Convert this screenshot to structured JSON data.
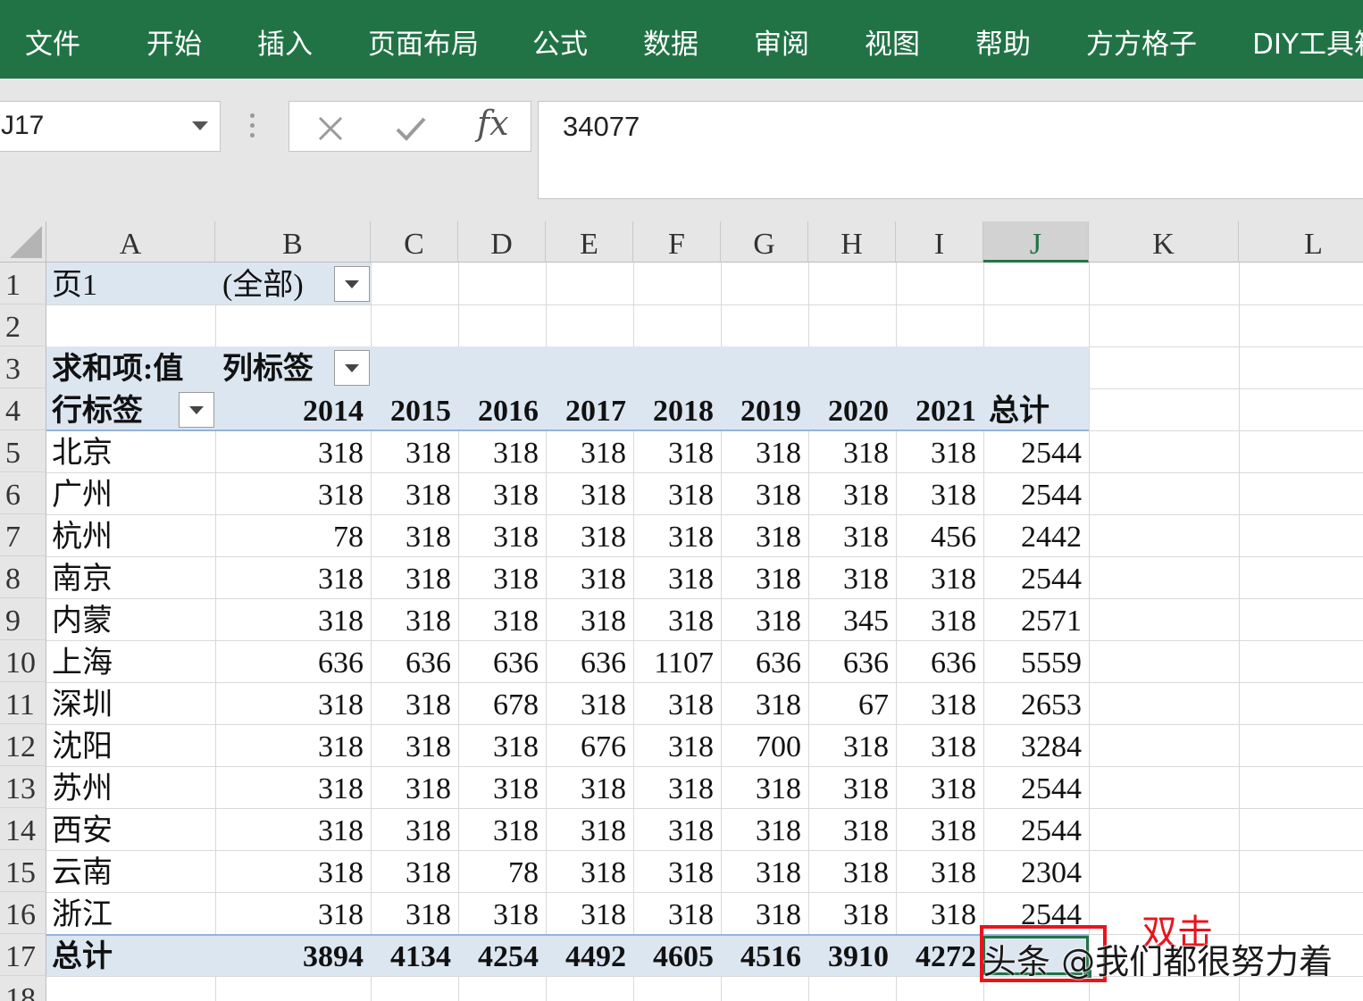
{
  "ribbon": {
    "tabs": [
      "文件",
      "开始",
      "插入",
      "页面布局",
      "公式",
      "数据",
      "审阅",
      "视图",
      "帮助",
      "方方格子",
      "DIY工具箱"
    ]
  },
  "formula_bar": {
    "name_box": "J17",
    "cancel_icon": "close-icon",
    "enter_icon": "check-icon",
    "fx_label": "fx",
    "value": "34077"
  },
  "columns": [
    "A",
    "B",
    "C",
    "D",
    "E",
    "F",
    "G",
    "H",
    "I",
    "J",
    "K",
    "L"
  ],
  "selected_column": "J",
  "rows": [
    "1",
    "2",
    "3",
    "4",
    "5",
    "6",
    "7",
    "8",
    "9",
    "10",
    "11",
    "12",
    "13",
    "14",
    "15",
    "16",
    "17",
    "18"
  ],
  "pivot": {
    "page_field_label": "页1",
    "page_field_value": "(全部)",
    "values_label": "求和项:值",
    "col_labels_label": "列标签",
    "row_labels_label": "行标签",
    "years": [
      "2014",
      "2015",
      "2016",
      "2017",
      "2018",
      "2019",
      "2020",
      "2021"
    ],
    "grand_total_header": "总计",
    "data": [
      {
        "city": "北京",
        "values": [
          "318",
          "318",
          "318",
          "318",
          "318",
          "318",
          "318",
          "318"
        ],
        "total": "2544"
      },
      {
        "city": "广州",
        "values": [
          "318",
          "318",
          "318",
          "318",
          "318",
          "318",
          "318",
          "318"
        ],
        "total": "2544"
      },
      {
        "city": "杭州",
        "values": [
          "78",
          "318",
          "318",
          "318",
          "318",
          "318",
          "318",
          "456"
        ],
        "total": "2442"
      },
      {
        "city": "南京",
        "values": [
          "318",
          "318",
          "318",
          "318",
          "318",
          "318",
          "318",
          "318"
        ],
        "total": "2544"
      },
      {
        "city": "内蒙",
        "values": [
          "318",
          "318",
          "318",
          "318",
          "318",
          "318",
          "345",
          "318"
        ],
        "total": "2571"
      },
      {
        "city": "上海",
        "values": [
          "636",
          "636",
          "636",
          "636",
          "1107",
          "636",
          "636",
          "636"
        ],
        "total": "5559"
      },
      {
        "city": "深圳",
        "values": [
          "318",
          "318",
          "678",
          "318",
          "318",
          "318",
          "67",
          "318"
        ],
        "total": "2653"
      },
      {
        "city": "沈阳",
        "values": [
          "318",
          "318",
          "318",
          "676",
          "318",
          "700",
          "318",
          "318"
        ],
        "total": "3284"
      },
      {
        "city": "苏州",
        "values": [
          "318",
          "318",
          "318",
          "318",
          "318",
          "318",
          "318",
          "318"
        ],
        "total": "2544"
      },
      {
        "city": "西安",
        "values": [
          "318",
          "318",
          "318",
          "318",
          "318",
          "318",
          "318",
          "318"
        ],
        "total": "2544"
      },
      {
        "city": "云南",
        "values": [
          "318",
          "318",
          "78",
          "318",
          "318",
          "318",
          "318",
          "318"
        ],
        "total": "2304"
      },
      {
        "city": "浙江",
        "values": [
          "318",
          "318",
          "318",
          "318",
          "318",
          "318",
          "318",
          "318"
        ],
        "total": "2544"
      }
    ],
    "grand_total_label": "总计",
    "grand_totals": [
      "3894",
      "4134",
      "4254",
      "4492",
      "4605",
      "4516",
      "3910",
      "4272"
    ]
  },
  "annotation": "双击",
  "watermark": "头条 @我们都很努力着",
  "colors": {
    "ribbon": "#217346",
    "pivot_band": "#dce6f1",
    "highlight": "#e8141e"
  }
}
